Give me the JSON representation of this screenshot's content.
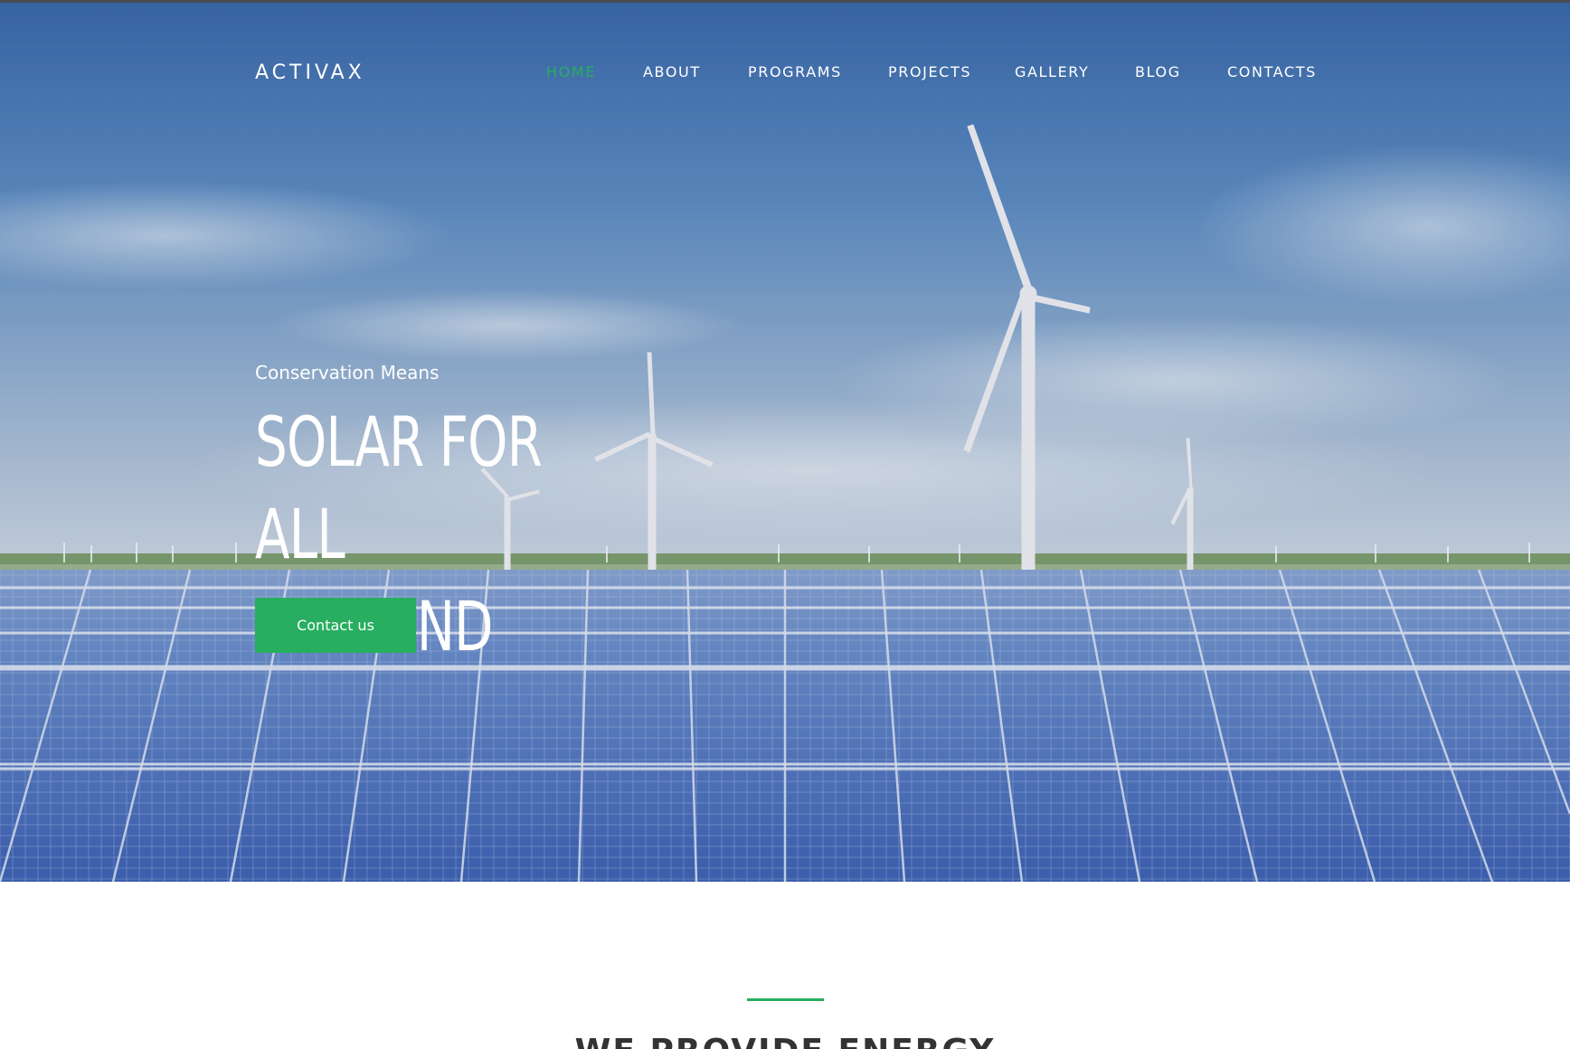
{
  "brand": {
    "logo_text": "ACTIVAX"
  },
  "nav": {
    "items": [
      {
        "label": "HOME",
        "active": true
      },
      {
        "label": "ABOUT",
        "active": false
      },
      {
        "label": "PROGRAMS",
        "active": false
      },
      {
        "label": "PROJECTS",
        "active": false
      },
      {
        "label": "GALLERY",
        "active": false
      },
      {
        "label": "BLOG",
        "active": false
      },
      {
        "label": "CONTACTS",
        "active": false
      }
    ]
  },
  "hero": {
    "eyebrow": "Conservation Means",
    "headline_line1": "SOLAR FOR ALL",
    "headline_line2": "MANKIND",
    "cta_label": "Contact us",
    "background_icon": "solar-panels-and-wind-turbines-photo"
  },
  "section": {
    "title": "WE PROVIDE ENERGY"
  },
  "colors": {
    "accent": "#27ae60",
    "nav_text": "#ffffff",
    "sky_top": "#3c6fb0",
    "sky_bottom": "#c8d5e2",
    "panel_blue": "#3f6fc0",
    "title_text": "#333333"
  }
}
